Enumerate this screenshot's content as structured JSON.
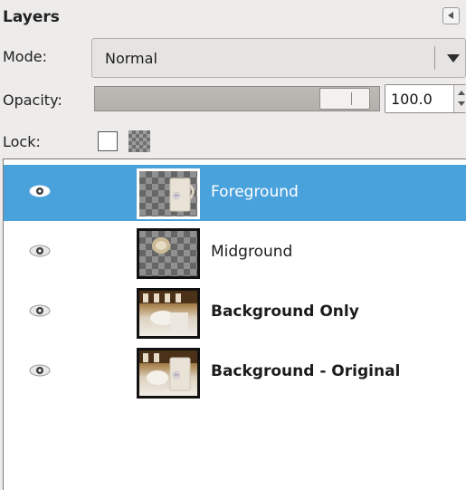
{
  "panel": {
    "title": "Layers",
    "menu_icon": "tab-menu-icon"
  },
  "mode": {
    "label": "Mode:",
    "value": "Normal"
  },
  "opacity": {
    "label": "Opacity:",
    "value": "100.0",
    "level": 1.0
  },
  "lock": {
    "label": "Lock:",
    "pixels_locked": false,
    "alpha_locked": false
  },
  "layers": [
    {
      "name": "Foreground",
      "visible": true,
      "selected": true,
      "bold": false,
      "thumbnail": "transparent-with-mug"
    },
    {
      "name": "Midground",
      "visible": true,
      "selected": false,
      "bold": false,
      "thumbnail": "transparent-with-mug"
    },
    {
      "name": "Background Only",
      "visible": true,
      "selected": false,
      "bold": true,
      "thumbnail": "photo"
    },
    {
      "name": "Background - Original",
      "visible": true,
      "selected": false,
      "bold": true,
      "thumbnail": "photo-with-mug"
    }
  ],
  "colors": {
    "selection": "#4aa2dd",
    "panel_bg": "#edeceb",
    "list_bg": "#ffffff"
  }
}
